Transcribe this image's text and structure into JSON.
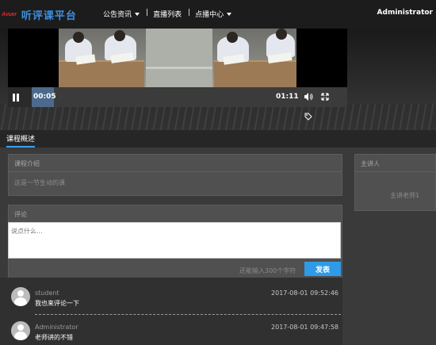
{
  "header": {
    "logo_mark": "Avuer",
    "logo_text": "听评课平台",
    "nav": [
      {
        "label": "公告资讯",
        "has_dropdown": true,
        "separator": "|"
      },
      {
        "label": "直播列表",
        "has_dropdown": false,
        "separator": "|"
      },
      {
        "label": "点播中心",
        "has_dropdown": true,
        "separator": ""
      }
    ],
    "user": "Administrator"
  },
  "player": {
    "current_time": "00:05",
    "duration": "01:11",
    "progress_fraction": 0.07,
    "icons": [
      "pause-icon",
      "volume-icon",
      "fullscreen-icon",
      "tag-icon"
    ]
  },
  "tabs": {
    "active": "课程概述"
  },
  "course_intro": {
    "title": "课程介绍",
    "body": "这是一节生动的课"
  },
  "speaker": {
    "title": "主讲人",
    "name": "主讲老师1"
  },
  "comments": {
    "title": "评论",
    "placeholder": "说点什么...",
    "remaining": "还能输入300个字符",
    "submit_label": "发表",
    "items": [
      {
        "user": "student",
        "text": "我也来评论一下",
        "time": "2017-08-01 09:52:46"
      },
      {
        "user": "Administrator",
        "text": "老师讲的不错",
        "time": "2017-08-01 09:47:58"
      }
    ]
  },
  "colors": {
    "accent": "#2f9be8",
    "header_bg": "#1c1c1c",
    "panel_bg": "#505050",
    "logo_red": "#e0282c",
    "logo_blue": "#3d8fe0"
  }
}
